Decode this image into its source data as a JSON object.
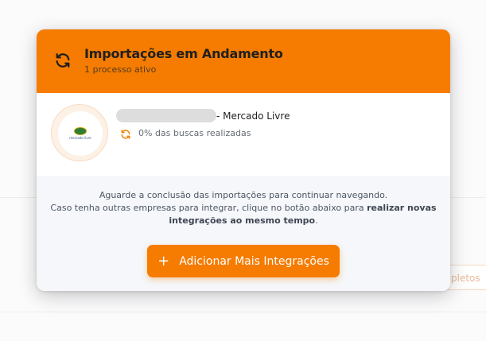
{
  "background": {
    "chip_label": "pletos"
  },
  "modal": {
    "title": "Importações em Andamento",
    "subtitle": "1 processo ativo",
    "header_icon": "sync-icon",
    "accent_color": "#f57c00"
  },
  "import_item": {
    "marketplace_logo_text": "mercado livre",
    "title_suffix": "- Mercado Livre",
    "status_icon": "sync-icon",
    "status_text": "0% das buscas realizadas"
  },
  "footer": {
    "line1": "Aguarde a conclusão das importações para continuar navegando.",
    "line2_prefix": "Caso tenha outras empresas para integrar, clique no botão abaixo para ",
    "line2_bold": "realizar novas integrações ao mesmo tempo",
    "line2_suffix": ".",
    "add_button_label": "Adicionar Mais Integrações"
  }
}
